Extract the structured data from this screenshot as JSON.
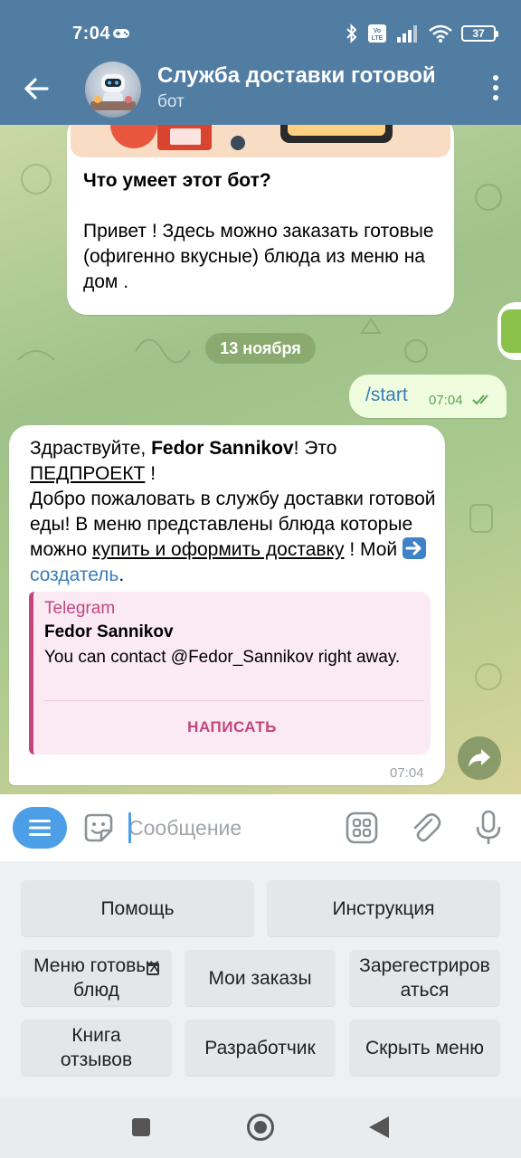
{
  "status_bar": {
    "time": "7:04",
    "battery": "37"
  },
  "header": {
    "title": "Служба доставки готовой",
    "subtitle": "бот"
  },
  "intro_card": {
    "title": "Что умеет этот бот?",
    "text": "Привет ! Здесь можно заказать готовые (офигенно вкусные) блюда из меню на дом ."
  },
  "date_chip": "13 ноября",
  "outgoing": {
    "text": "/start",
    "time": "07:04"
  },
  "incoming": {
    "greeting": "Здраствуйте, ",
    "name": "Fedor Sannikov",
    "after_name": "! Это",
    "project": "ПЕДПРОЕКТ",
    "after_project": " !",
    "line2": "Добро пожаловать в службу доставки готовой еды! В меню представлены блюда которые можно ",
    "link_order": "купить и оформить доставку",
    "line3": " ! Мой ",
    "link_creator": "создатель",
    "end": ".",
    "time": "07:04",
    "preview": {
      "site": "Telegram",
      "title": "Fedor Sannikov",
      "description": "You can contact @Fedor_Sannikov right away.",
      "button": "НАПИСАТЬ"
    }
  },
  "input": {
    "placeholder": "Сообщение"
  },
  "keyboard": {
    "help": "Помощь",
    "instructions": "Инструкция",
    "menu": "Меню готовых блюд",
    "my_orders": "Мои заказы",
    "register": "Зарегестрироваться",
    "reviews": "Книга отзывов",
    "developer": "Разработчик",
    "hide_menu": "Скрыть меню"
  },
  "colors": {
    "header_bg": "#517da2",
    "outgoing_bubble": "#effdde",
    "link": "#3a7cb8",
    "preview_accent": "#c2457f",
    "keyboard_button_accent": "#4c9fe6"
  }
}
